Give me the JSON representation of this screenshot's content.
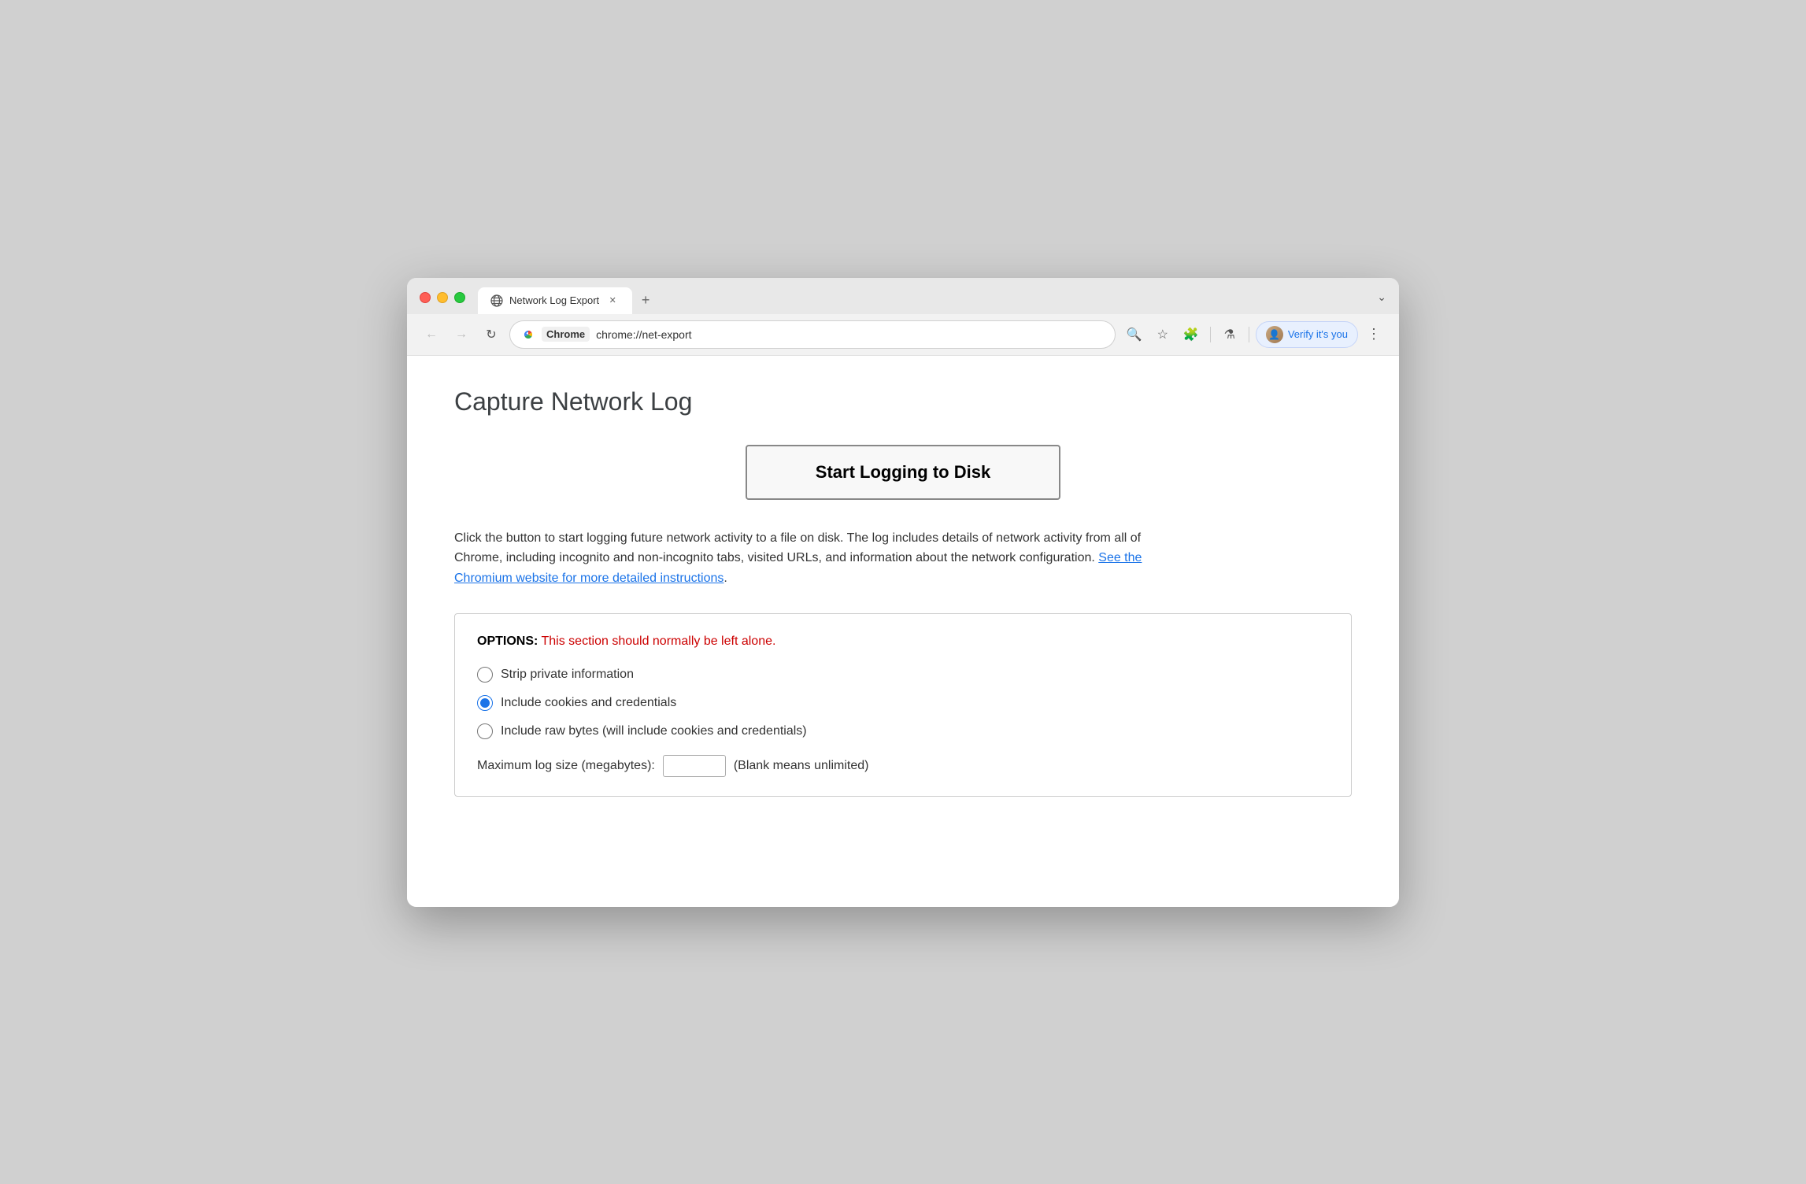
{
  "window": {
    "title": "Network Log Export",
    "url": "chrome://net-export",
    "chrome_label": "Chrome",
    "chevron": "⌄"
  },
  "traffic_lights": {
    "close": "close",
    "minimize": "minimize",
    "maximize": "maximize"
  },
  "tab": {
    "title": "Network Log Export",
    "close_label": "✕",
    "new_tab_label": "+"
  },
  "nav": {
    "back_label": "←",
    "forward_label": "→",
    "reload_label": "↻"
  },
  "toolbar": {
    "zoom_icon": "🔍",
    "star_icon": "☆",
    "extension_icon": "🧩",
    "flask_icon": "⚗",
    "verify_label": "Verify it's you",
    "menu_label": "⋮"
  },
  "page": {
    "title": "Capture Network Log",
    "start_button_label": "Start Logging to Disk",
    "description": "Click the button to start logging future network activity to a file on disk. The log includes details of network activity from all of Chrome, including incognito and non-incognito tabs, visited URLs, and information about the network configuration. ",
    "link_text": "See the Chromium website for more detailed instructions",
    "link_suffix": ".",
    "options": {
      "header_bold": "OPTIONS:",
      "header_warning": " This section should normally be left alone.",
      "radio_items": [
        {
          "id": "strip",
          "label": "Strip private information",
          "checked": false
        },
        {
          "id": "cookies",
          "label": "Include cookies and credentials",
          "checked": true
        },
        {
          "id": "rawbytes",
          "label": "Include raw bytes (will include cookies and credentials)",
          "checked": false
        }
      ],
      "max_size_label": "Maximum log size (megabytes):",
      "max_size_hint": "(Blank means unlimited)"
    }
  }
}
